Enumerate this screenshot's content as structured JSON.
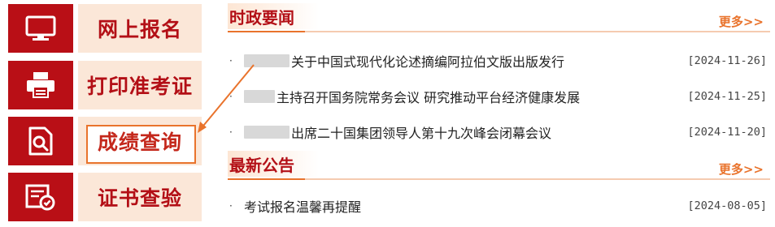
{
  "quick_links": [
    {
      "label": "网上报名",
      "icon": "monitor-icon"
    },
    {
      "label": "打印准考证",
      "icon": "printer-icon"
    },
    {
      "label": "成绩查询",
      "icon": "search-document-icon",
      "highlighted": true
    },
    {
      "label": "证书查验",
      "icon": "certificate-check-icon"
    }
  ],
  "news": {
    "title": "时政要闻",
    "more": "更多>>",
    "items": [
      {
        "text": "关于中国式现代化论述摘编阿拉伯文版出版发行",
        "date": "[2024-11-26]"
      },
      {
        "text": "主持召开国务院常务会议 研究推动平台经济健康发展",
        "date": "[2024-11-25]"
      },
      {
        "text": "出席二十国集团领导人第十九次峰会闭幕会议",
        "date": "[2024-11-20]"
      }
    ]
  },
  "notices": {
    "title": "最新公告",
    "more": "更多>>",
    "items": [
      {
        "text": "考试报名温馨再提醒",
        "date": "[2024-08-05]"
      }
    ]
  },
  "colors": {
    "brand_red": "#b90f16",
    "accent_orange": "#e9732c",
    "label_bg": "#fbe7d8"
  }
}
